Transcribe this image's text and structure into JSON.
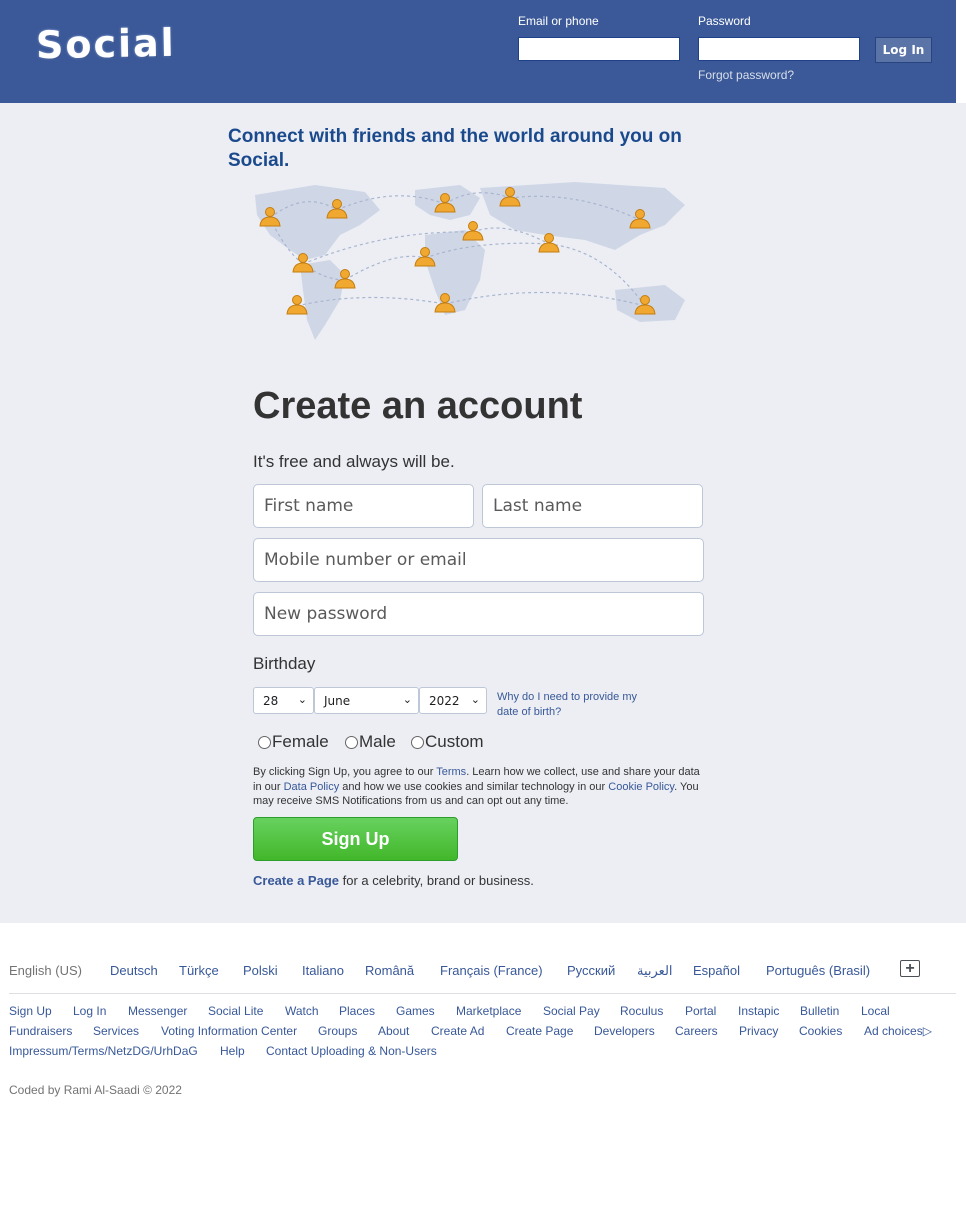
{
  "header": {
    "logo_text": "Social",
    "email_label": "Email or phone",
    "password_label": "Password",
    "login_button": "Log In",
    "forgot_password": "Forgot password?"
  },
  "hero": {
    "tagline": "Connect with friends and the world around you on Social."
  },
  "signup": {
    "title": "Create an account",
    "subtitle": "It's free and always will be.",
    "first_name_placeholder": "First name",
    "last_name_placeholder": "Last name",
    "mobile_placeholder": "Mobile number or email",
    "password_placeholder": "New password",
    "birthday_label": "Birthday",
    "birthday_day": "28",
    "birthday_month": "June",
    "birthday_year": "2022",
    "why_birthday": "Why do I need to provide my date of birth?",
    "gender_female": "Female",
    "gender_male": "Male",
    "gender_custom": "Custom",
    "terms_1": "By clicking Sign Up, you agree to our ",
    "terms_link": "Terms",
    "terms_2": ". Learn how we collect, use and share your data in our ",
    "data_policy_link": "Data Policy",
    "terms_3": " and how we use cookies and similar technology in our ",
    "cookie_policy_link": "Cookie Policy",
    "terms_4": ". You may receive SMS Notifications from us and can opt out any time.",
    "signup_button": "Sign Up",
    "create_page_link": "Create a Page",
    "create_page_rest": " for a celebrity, brand or business."
  },
  "footer": {
    "languages": [
      "English (US)",
      "Deutsch",
      "Türkçe",
      "Polski",
      "Italiano",
      "Română",
      "Français (France)",
      "Русский",
      "العربية",
      "Español",
      "Português (Brasil)"
    ],
    "links_row1": [
      "Sign Up",
      "Log In",
      "Messenger",
      "Social Lite",
      "Watch",
      "Places",
      "Games",
      "Marketplace",
      "Social Pay",
      "Roculus",
      "Portal",
      "Instapic",
      "Bulletin",
      "Local"
    ],
    "links_row2": [
      "Fundraisers",
      "Services",
      "Voting Information Center",
      "Groups",
      "About",
      "Create Ad",
      "Create Page",
      "Developers",
      "Careers",
      "Privacy",
      "Cookies",
      "Ad choices▷"
    ],
    "links_row3": [
      "Impressum/Terms/NetzDG/UrhDaG",
      "Help",
      "Contact Uploading & Non-Users"
    ],
    "copyright": "Coded by Rami Al-Saadi © 2022"
  },
  "colors": {
    "header_bg": "#3b5998",
    "page_bg": "#eceef4",
    "accent": "#1b4a8c",
    "signup_green": "#42b72a",
    "link": "#385898"
  }
}
